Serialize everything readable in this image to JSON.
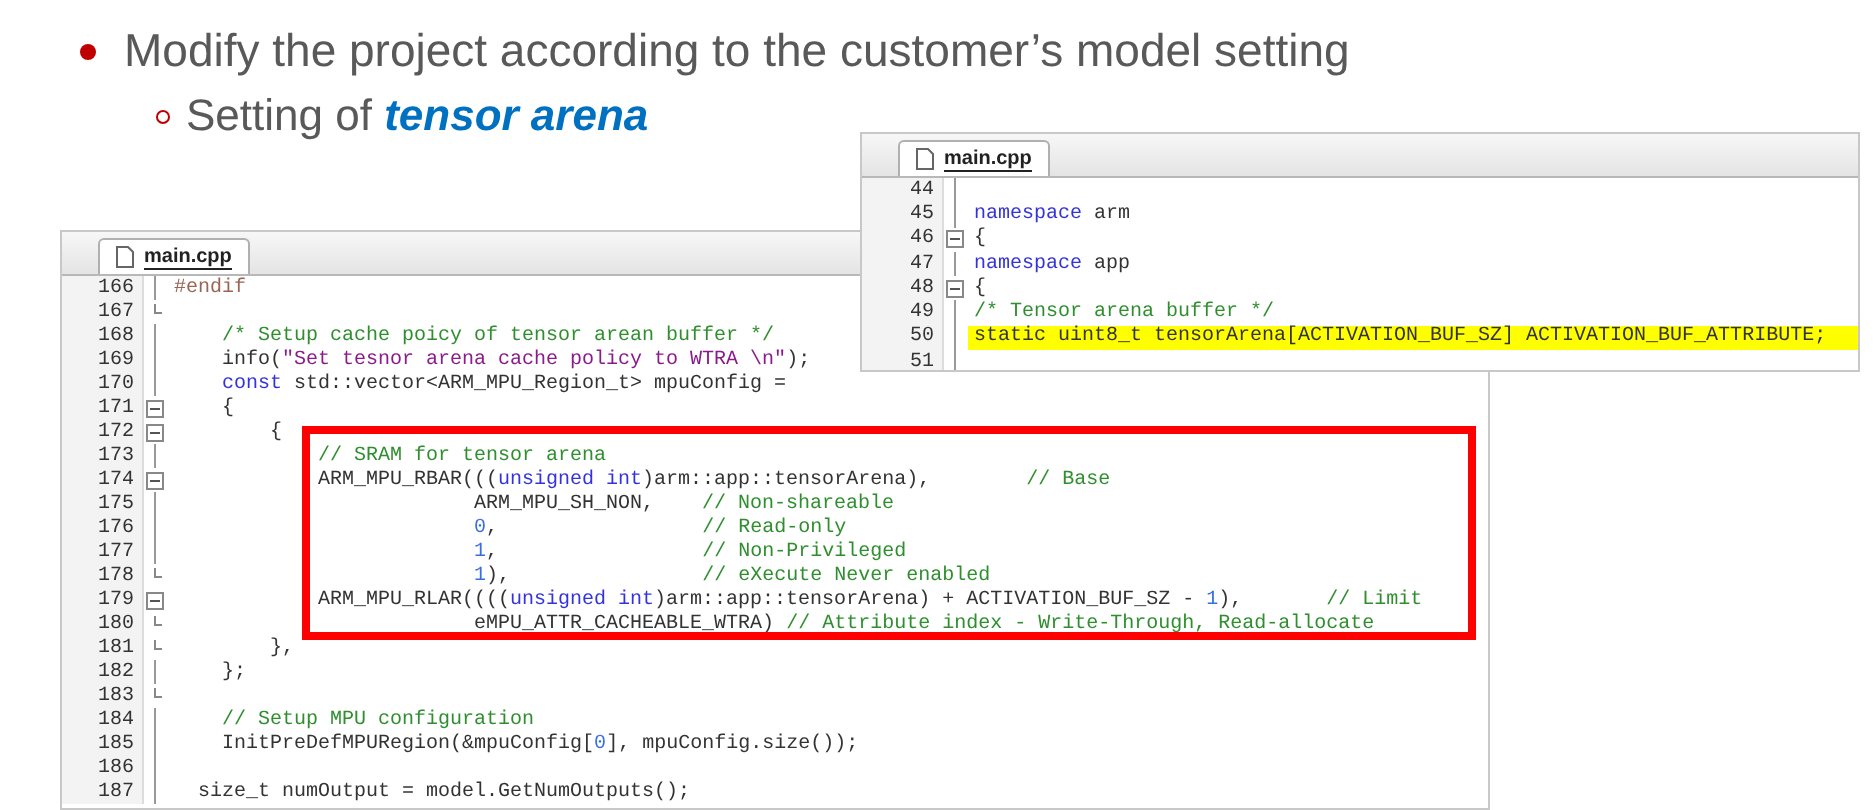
{
  "bullets": [
    {
      "kind": "main",
      "text": "Modify the project according to the customer’s model setting"
    },
    {
      "kind": "sub",
      "text": "Setting of **tensor arena**"
    }
  ],
  "editors": [
    {
      "tab": "main.cpp",
      "sections": [
        {
          "boxed": false,
          "lines": [
            {
              "n": "44",
              "kind": "plain",
              "highlighted": false
            },
            {
              "n": "45",
              "kind": "plain",
              "highlighted": false,
              "tokens": [
                {
                  "kind": "keyword",
                  "text": "namespace"
                },
                {
                  "kind": "plain",
                  "text": " arm"
                }
              ]
            },
            {
              "n": "46",
              "kind": "fold-start",
              "highlighted": false,
              "tokens": [
                {
                  "kind": "plain",
                  "text": "{"
                }
              ]
            },
            {
              "n": "47",
              "kind": "plain",
              "highlighted": false,
              "tokens": [
                {
                  "kind": "keyword",
                  "text": "namespace"
                },
                {
                  "kind": "plain",
                  "text": " app"
                }
              ]
            },
            {
              "n": "48",
              "kind": "fold-start",
              "highlighted": false,
              "tokens": [
                {
                  "kind": "plain",
                  "text": "{"
                }
              ]
            },
            {
              "n": "49",
              "kind": "plain",
              "highlighted": false,
              "tokens": [
                {
                  "kind": "comment",
                  "text": "/* Tensor arena buffer */"
                }
              ]
            },
            {
              "n": "50",
              "kind": "plain",
              "highlighted": true,
              "tokens": [
                {
                  "kind": "plain",
                  "text": "static uint8_t tensorArena[ACTIVATION_BUF_SZ] ACTIVATION_BUF_ATTRIBUTE;"
                }
              ]
            },
            {
              "n": "51",
              "kind": "plain",
              "highlighted": false
            }
          ]
        }
      ]
    },
    {
      "tab": "main.cpp",
      "sections": [
        {
          "boxed": false,
          "lines": [
            {
              "n": "166",
              "kind": "plain",
              "tokens": [
                {
                  "kind": "preprocessor",
                  "text": "#endif"
                }
              ]
            },
            {
              "n": "167",
              "kind": "fold-end"
            },
            {
              "n": "168",
              "kind": "plain",
              "tokens": [
                {
                  "kind": "comment",
                  "text": "    /* Setup cache poicy of tensor arean buffer */"
                }
              ]
            },
            {
              "n": "169",
              "kind": "plain",
              "tokens": [
                {
                  "kind": "plain",
                  "text": "    info("
                },
                {
                  "kind": "string",
                  "text": "\"Set tesnor arena cache policy to WTRA \\n\""
                },
                {
                  "kind": "plain",
                  "text": ");"
                }
              ]
            },
            {
              "n": "170",
              "kind": "plain",
              "tokens": [
                {
                  "kind": "keyword",
                  "text": "    const"
                },
                {
                  "kind": "plain",
                  "text": " std::vector<ARM_MPU_Region_t> mpuConfig ="
                }
              ]
            },
            {
              "n": "171",
              "kind": "fold-start",
              "tokens": [
                {
                  "kind": "plain",
                  "text": "    {"
                }
              ]
            },
            {
              "n": "172",
              "kind": "fold-start",
              "tokens": [
                {
                  "kind": "plain",
                  "text": "        {"
                }
              ]
            }
          ]
        },
        {
          "boxed": true,
          "lines": [
            {
              "n": "173",
              "kind": "plain",
              "tokens": [
                {
                  "kind": "comment",
                  "text": "            // SRAM for tensor arena"
                }
              ]
            },
            {
              "n": "174",
              "kind": "fold-start",
              "tokens": [
                {
                  "kind": "plain",
                  "text": "            ARM_MPU_RBAR((("
                },
                {
                  "kind": "keyword",
                  "text": "unsigned int"
                },
                {
                  "kind": "plain",
                  "text": ")arm::app::tensorArena),        "
                },
                {
                  "kind": "comment",
                  "text": "// Base"
                }
              ]
            },
            {
              "n": "175",
              "kind": "plain",
              "tokens": [
                {
                  "kind": "plain",
                  "text": "                         ARM_MPU_SH_NON,    "
                },
                {
                  "kind": "comment",
                  "text": "// Non-shareable"
                }
              ]
            },
            {
              "n": "176",
              "kind": "plain",
              "tokens": [
                {
                  "kind": "number",
                  "text": "                         0"
                },
                {
                  "kind": "plain",
                  "text": ",                 "
                },
                {
                  "kind": "comment",
                  "text": "// Read-only"
                }
              ]
            },
            {
              "n": "177",
              "kind": "plain",
              "tokens": [
                {
                  "kind": "number",
                  "text": "                         1"
                },
                {
                  "kind": "plain",
                  "text": ",                 "
                },
                {
                  "kind": "comment",
                  "text": "// Non-Privileged"
                }
              ]
            },
            {
              "n": "178",
              "kind": "fold-end",
              "tokens": [
                {
                  "kind": "number",
                  "text": "                         1"
                },
                {
                  "kind": "plain",
                  "text": "),                "
                },
                {
                  "kind": "comment",
                  "text": "// eXecute Never enabled"
                }
              ]
            },
            {
              "n": "179",
              "kind": "fold-start",
              "tokens": [
                {
                  "kind": "plain",
                  "text": "            ARM_MPU_RLAR(((("
                },
                {
                  "kind": "keyword",
                  "text": "unsigned int"
                },
                {
                  "kind": "plain",
                  "text": ")arm::app::tensorArena) + ACTIVATION_BUF_SZ - "
                },
                {
                  "kind": "number",
                  "text": "1"
                },
                {
                  "kind": "plain",
                  "text": "),       "
                },
                {
                  "kind": "comment",
                  "text": "// Limit"
                }
              ]
            },
            {
              "n": "180",
              "kind": "fold-end",
              "tokens": [
                {
                  "kind": "plain",
                  "text": "                         eMPU_ATTR_CACHEABLE_WTRA) "
                },
                {
                  "kind": "comment",
                  "text": "// Attribute index - Write-Through, Read-allocate"
                }
              ]
            }
          ]
        },
        {
          "boxed": false,
          "lines": [
            {
              "n": "181",
              "kind": "fold-end",
              "tokens": [
                {
                  "kind": "plain",
                  "text": "        },"
                }
              ]
            },
            {
              "n": "182",
              "kind": "plain",
              "tokens": [
                {
                  "kind": "plain",
                  "text": "    };"
                }
              ]
            },
            {
              "n": "183",
              "kind": "fold-end"
            },
            {
              "n": "184",
              "kind": "plain",
              "tokens": [
                {
                  "kind": "comment",
                  "text": "    // Setup MPU configuration"
                }
              ]
            },
            {
              "n": "185",
              "kind": "plain",
              "tokens": [
                {
                  "kind": "plain",
                  "text": "    InitPreDefMPURegion(&mpuConfig["
                },
                {
                  "kind": "number",
                  "text": "0"
                },
                {
                  "kind": "plain",
                  "text": "], mpuConfig.size());"
                }
              ]
            },
            {
              "n": "186",
              "kind": "plain"
            },
            {
              "n": "187",
              "kind": "plain",
              "tokens": [
                {
                  "kind": "plain",
                  "text": "  size_t numOutput = model.GetNumOutputs();"
                }
              ]
            }
          ]
        }
      ]
    }
  ]
}
